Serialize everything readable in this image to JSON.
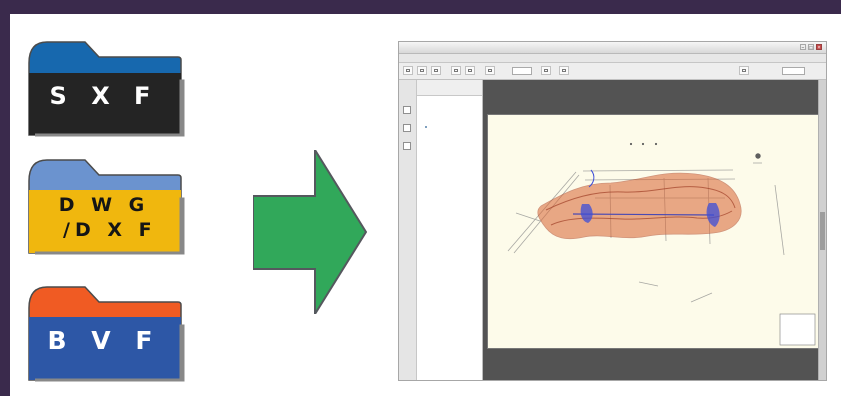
{
  "formats": [
    {
      "label": "S X F",
      "tab_color": "#1768ae",
      "body_color": "#242424",
      "text_color": "#ffffff"
    },
    {
      "label": "D W G\n /D X F",
      "tab_color": "#6b93cf",
      "body_color": "#f0b70e",
      "text_color": "#151515"
    },
    {
      "label": "B V F",
      "tab_color": "#f05b23",
      "body_color": "#2d57a6",
      "text_color": "#ffffff"
    }
  ],
  "arrow": {
    "fill": "#31a85a",
    "stroke": "#55585e",
    "icon": "right-arrow-icon"
  },
  "viewer": {
    "title": "",
    "menus": [
      "",
      "",
      "",
      "",
      ""
    ],
    "page_number": "",
    "zoom_level": "",
    "bookmarks_title": "",
    "bookmarks": [
      "",
      "",
      "",
      "",
      "",
      "",
      "",
      "",
      ""
    ],
    "icons": [
      "document-icon",
      "back-icon",
      "forward-icon",
      "zoom-icon",
      "bookmark-icon",
      "scrollbar-icon"
    ]
  },
  "drawing": {
    "legend_text": [
      "",
      "",
      "",
      ""
    ],
    "colors": {
      "paper": "#fdfbea",
      "survey_fill": "#d96b3b",
      "survey_stroke": "#b14b2c",
      "blue_marker": "#3c4dd8",
      "line": "#777777"
    }
  },
  "colors": {
    "frame": "#3a2a4c",
    "panel": "#ffffff",
    "viewer_dark": "#535353"
  }
}
